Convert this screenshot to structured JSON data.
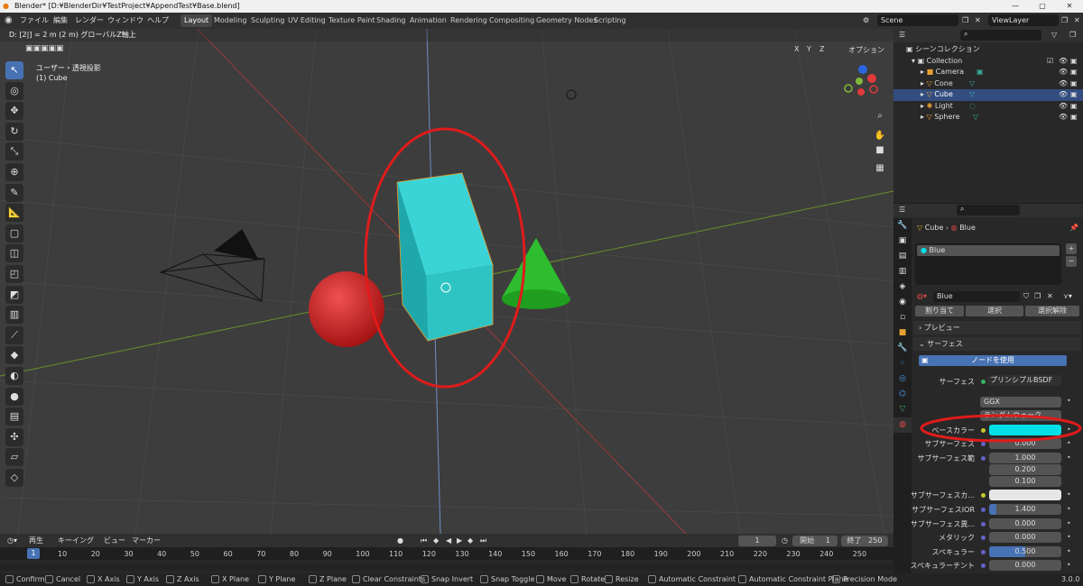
{
  "window": {
    "title": "Blender* [D:¥BlenderDir¥TestProject¥AppendTest¥Base.blend]"
  },
  "menu": [
    "ファイル",
    "編集",
    "レンダー",
    "ウィンドウ",
    "ヘルプ"
  ],
  "workspaces": [
    "Layout",
    "Modeling",
    "Sculpting",
    "UV Editing",
    "Texture Paint",
    "Shading",
    "Animation",
    "Rendering",
    "Compositing",
    "Geometry Nodes",
    "Scripting"
  ],
  "scene": {
    "name": "Scene",
    "view_layer": "ViewLayer"
  },
  "viewport": {
    "status_text": "D: [2|] = 2 m (2 m) グローバルZ軸上",
    "view_name": "ユーザー・透視投影",
    "object_name": "(1) Cube",
    "axis_buttons": [
      "X",
      "Y",
      "Z"
    ],
    "options_label": "オプション"
  },
  "outliner": {
    "scene_collection": "シーンコレクション",
    "collection": "Collection",
    "objects": [
      "Camera",
      "Cone",
      "Cube",
      "Light",
      "Sphere"
    ],
    "selected": "Cube"
  },
  "properties": {
    "breadcrumb_object": "Cube",
    "breadcrumb_material": "Blue",
    "slot_name": "Blue",
    "material_name": "Blue",
    "buttons": [
      "割り当て",
      "選択",
      "選択解除"
    ],
    "panel_preview": "プレビュー",
    "panel_surface": "サーフェス",
    "use_nodes": "ノードを使用",
    "surface_label": "サーフェス",
    "surface_value": "プリンシプルBSDF",
    "distribution": "GGX",
    "sss_method": "ランダムウォーク",
    "rows": [
      {
        "label": "ベースカラー",
        "value": ""
      },
      {
        "label": "サブサーフェス",
        "value": "0.000"
      },
      {
        "label": "サブサーフェス範",
        "value": "1.000"
      },
      {
        "label": "",
        "value": "0.200"
      },
      {
        "label": "",
        "value": "0.100"
      },
      {
        "label": "サブサーフェスカ...",
        "value": ""
      },
      {
        "label": "サブサーフェスIOR",
        "value": "1.400"
      },
      {
        "label": "サブサーフェス異...",
        "value": "0.000"
      },
      {
        "label": "メタリック",
        "value": "0.000"
      },
      {
        "label": "スペキュラー",
        "value": "0.500"
      },
      {
        "label": "スペキュラーチント",
        "value": "0.000"
      }
    ],
    "base_color": "#00e0e6",
    "sss_color": "#e6e6e6"
  },
  "timeline": {
    "menu": [
      "再生",
      "キーイング",
      "ビュー",
      "マーカー"
    ],
    "current_frame": "1",
    "start_label": "開始",
    "start": "1",
    "end_label": "終了",
    "end": "250",
    "ticks": [
      "1",
      "10",
      "20",
      "30",
      "40",
      "50",
      "60",
      "70",
      "80",
      "90",
      "100",
      "110",
      "120",
      "130",
      "140",
      "150",
      "160",
      "170",
      "180",
      "190",
      "200",
      "210",
      "220",
      "230",
      "240",
      "250"
    ]
  },
  "statusbar": {
    "items": [
      "Confirm",
      "Cancel",
      "X Axis",
      "Y Axis",
      "Z Axis",
      "X Plane",
      "Y Plane",
      "Z Plane",
      "Clear Constraints",
      "Snap Invert",
      "Snap Toggle",
      "Move",
      "Rotate",
      "Resize",
      "Automatic Constraint",
      "Automatic Constraint Plane",
      "Precision Mode"
    ],
    "version": "3.0.0"
  },
  "colors": {
    "accent": "#4772b3",
    "selection": "#334d80",
    "cube": "#2ec4c4",
    "sphere": "#d42020",
    "cone": "#2ebd2e",
    "annotation": "#e01b1b"
  }
}
